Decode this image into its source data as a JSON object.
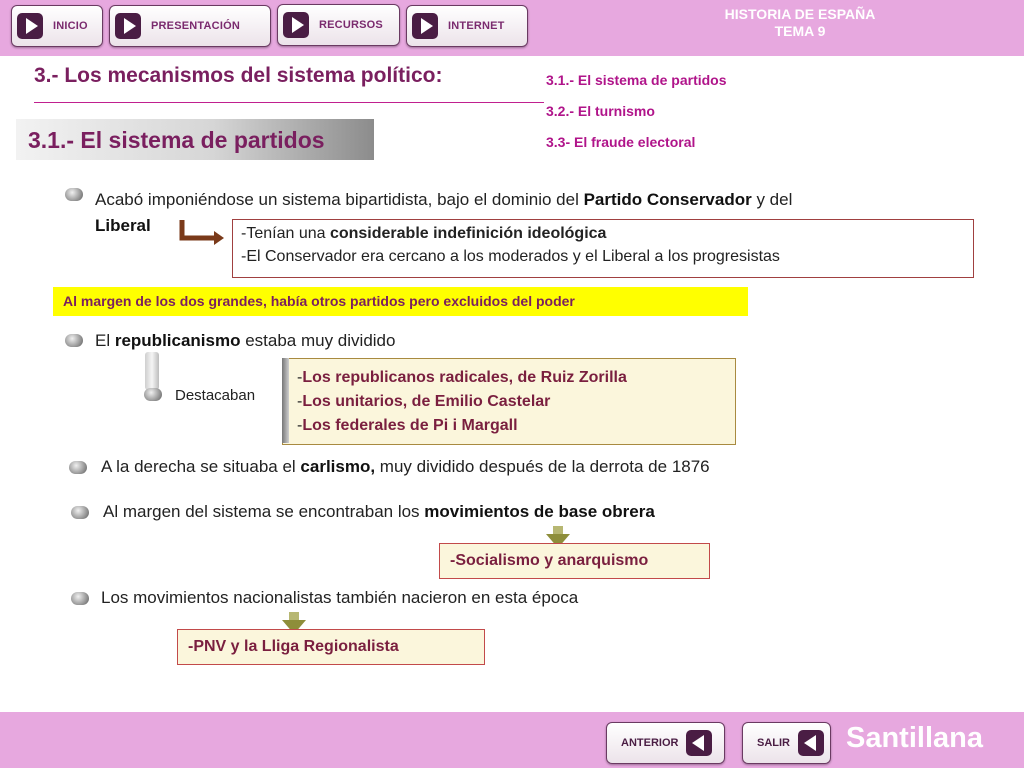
{
  "header": {
    "nav": [
      "INICIO",
      "PRESENTACIÓN",
      "RECURSOS",
      "INTERNET"
    ],
    "brand_line1": "HISTORIA DE ESPAÑA",
    "brand_line2": "TEMA 9"
  },
  "title": {
    "main": "3.- Los mecanismos del sistema político:",
    "section": "3.1.- El sistema de partidos"
  },
  "side_links": [
    "3.1.- El sistema de partidos",
    "3.2.- El turnismo",
    "3.3- El fraude electoral"
  ],
  "content": {
    "p1_a": "Acabó imponiéndose un sistema bipartidista, bajo el dominio del ",
    "p1_b": "Partido Conservador",
    "p1_c": " y del ",
    "p1_d": "Liberal",
    "box1_line1_a": "-Tenían una ",
    "box1_line1_b": "considerable indefinición ideológica",
    "box1_line2": "-El Conservador era cercano a los moderados y el Liberal a  los progresistas",
    "highlight": "Al margen de los dos grandes, había otros partidos pero excluidos del poder",
    "p2_a": "El ",
    "p2_b": "republicanismo",
    "p2_c": " estaba muy dividido",
    "destacaban": "Destacaban",
    "republican_groups": [
      "Los republicanos radicales, de Ruiz Zorilla",
      "Los unitarios, de Emilio Castelar",
      "Los federales de Pi i Margall"
    ],
    "dash": "-",
    "p3_a": "A la derecha se situaba el ",
    "p3_b": "carlismo,",
    "p3_c": " muy dividido después de la derrota de 1876",
    "p4_a": "Al margen del sistema se encontraban los ",
    "p4_b": "movimientos de base obrera",
    "tag1": "-Socialismo y anarquismo",
    "p5": "Los movimientos nacionalistas también nacieron en esta época",
    "tag2": "-PNV y la Lliga Regionalista"
  },
  "footer": {
    "prev": "ANTERIOR",
    "exit": "SALIR",
    "brand": "Santillana"
  },
  "colors": {
    "bar": "#e7a8df",
    "title": "#7a1f5f",
    "link": "#b0148a",
    "highlight": "#ffff00"
  }
}
